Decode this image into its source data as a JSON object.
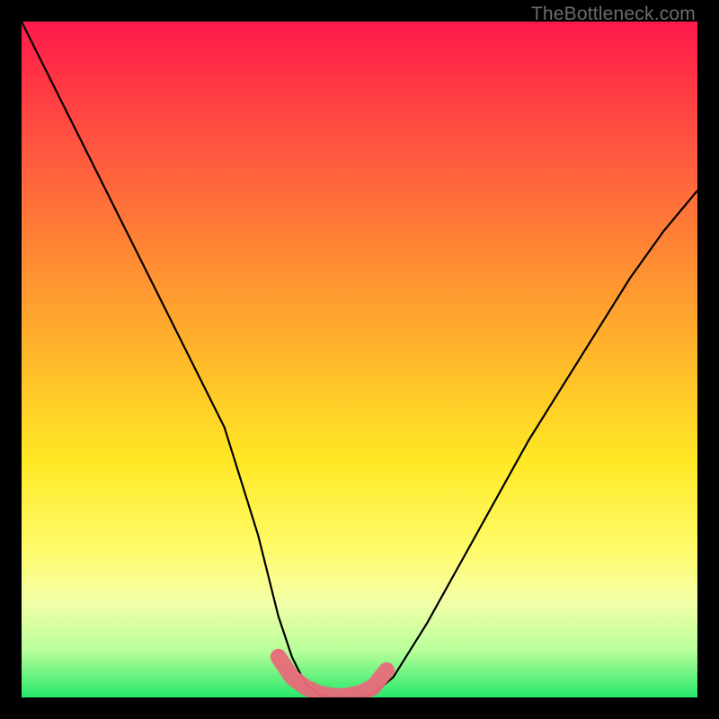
{
  "watermark": "TheBottleneck.com",
  "chart_data": {
    "type": "line",
    "title": "",
    "xlabel": "",
    "ylabel": "",
    "xlim": [
      0,
      100
    ],
    "ylim": [
      0,
      100
    ],
    "series": [
      {
        "name": "curve",
        "x": [
          0,
          5,
          10,
          15,
          20,
          25,
          30,
          35,
          38,
          40,
          42,
          44,
          46,
          48,
          50,
          52,
          55,
          60,
          65,
          70,
          75,
          80,
          85,
          90,
          95,
          100
        ],
        "y": [
          100,
          90,
          80,
          70,
          60,
          50,
          40,
          24,
          12,
          6,
          2,
          0.5,
          0,
          0,
          0,
          0.5,
          3,
          11,
          20,
          29,
          38,
          46,
          54,
          62,
          69,
          75
        ]
      },
      {
        "name": "bottom-highlight",
        "x": [
          38,
          40,
          42,
          44,
          46,
          48,
          50,
          52,
          54
        ],
        "y": [
          6,
          3,
          1.5,
          0.6,
          0.2,
          0.2,
          0.6,
          1.5,
          4
        ]
      }
    ],
    "colors": {
      "curve": "#000000",
      "highlight": "#e96a7a",
      "gradient_top": "#ff1a4d",
      "gradient_bottom": "#26e86a"
    }
  }
}
